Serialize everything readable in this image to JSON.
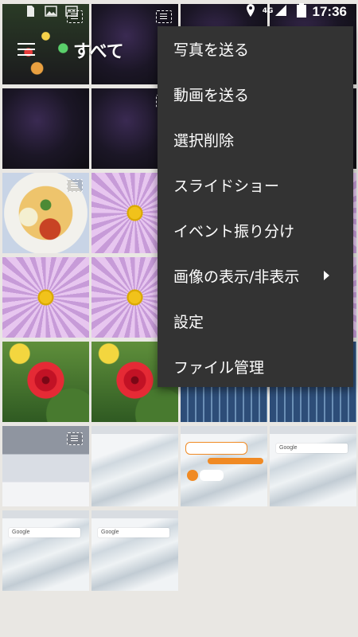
{
  "status_bar": {
    "time": "17:36",
    "network": "4G",
    "left_icons": [
      "sdcard-icon",
      "image-icon",
      "gallery-icon"
    ],
    "right_icons": [
      "location-icon",
      "signal-icon",
      "battery-icon"
    ]
  },
  "app_bar": {
    "menu_icon": "hamburger-icon",
    "title": "すべて"
  },
  "menu": {
    "items": [
      {
        "label": "写真を送る"
      },
      {
        "label": "動画を送る"
      },
      {
        "label": "選択削除"
      },
      {
        "label": "スライドショー"
      },
      {
        "label": "イベント振り分け"
      },
      {
        "label": "画像の表示/非表示",
        "submenu_icon": "arrow-right-icon"
      },
      {
        "label": "設定"
      },
      {
        "label": "ファイル管理"
      }
    ]
  },
  "grid": {
    "thumbnails": [
      {
        "kind": "xmas",
        "badge": true
      },
      {
        "kind": "night",
        "badge": true
      },
      {
        "kind": "night",
        "badge": false
      },
      {
        "kind": "night",
        "badge": false
      },
      {
        "kind": "night",
        "badge": false
      },
      {
        "kind": "night",
        "badge": true
      },
      {
        "kind": "pasta",
        "badge": true
      },
      {
        "kind": "daisy",
        "badge": false
      },
      {
        "kind": "daisy",
        "badge": false
      },
      {
        "kind": "daisy",
        "badge": false
      },
      {
        "kind": "rose",
        "badge": false
      },
      {
        "kind": "rose",
        "badge": false
      },
      {
        "kind": "building",
        "badge": false
      },
      {
        "kind": "building",
        "badge": false
      },
      {
        "kind": "office",
        "badge": true
      },
      {
        "kind": "screen",
        "badge": false
      },
      {
        "kind": "screen",
        "badge": false
      },
      {
        "kind": "screen",
        "badge": false
      },
      {
        "kind": "screen",
        "badge": false
      },
      {
        "kind": "screen",
        "badge": false
      }
    ]
  },
  "colors": {
    "menu_background": "#333333",
    "menu_text": "#ffffff",
    "page_background": "#e9e7e3"
  }
}
